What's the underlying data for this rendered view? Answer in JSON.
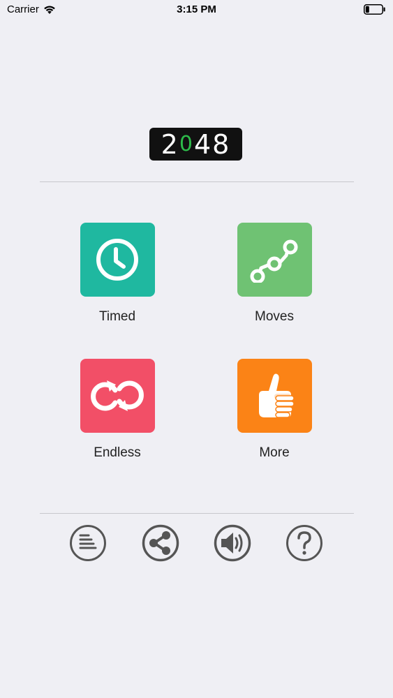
{
  "status_bar": {
    "carrier": "Carrier",
    "time": "3:15 PM"
  },
  "logo": {
    "digit1": "2",
    "digit2": "0",
    "digit3": "48"
  },
  "modes": [
    {
      "label": "Timed",
      "icon": "clock-icon",
      "color": "#1fb8a0"
    },
    {
      "label": "Moves",
      "icon": "path-icon",
      "color": "#6fc273"
    },
    {
      "label": "Endless",
      "icon": "infinity-loop-icon",
      "color": "#f24f67"
    },
    {
      "label": "More",
      "icon": "thumbs-up-icon",
      "color": "#fb8316"
    }
  ],
  "toolbar": [
    {
      "icon": "list-icon"
    },
    {
      "icon": "share-icon"
    },
    {
      "icon": "sound-icon"
    },
    {
      "icon": "help-icon"
    }
  ],
  "colors": {
    "background": "#efeff4",
    "logo_zero": "#2dbb4a"
  }
}
